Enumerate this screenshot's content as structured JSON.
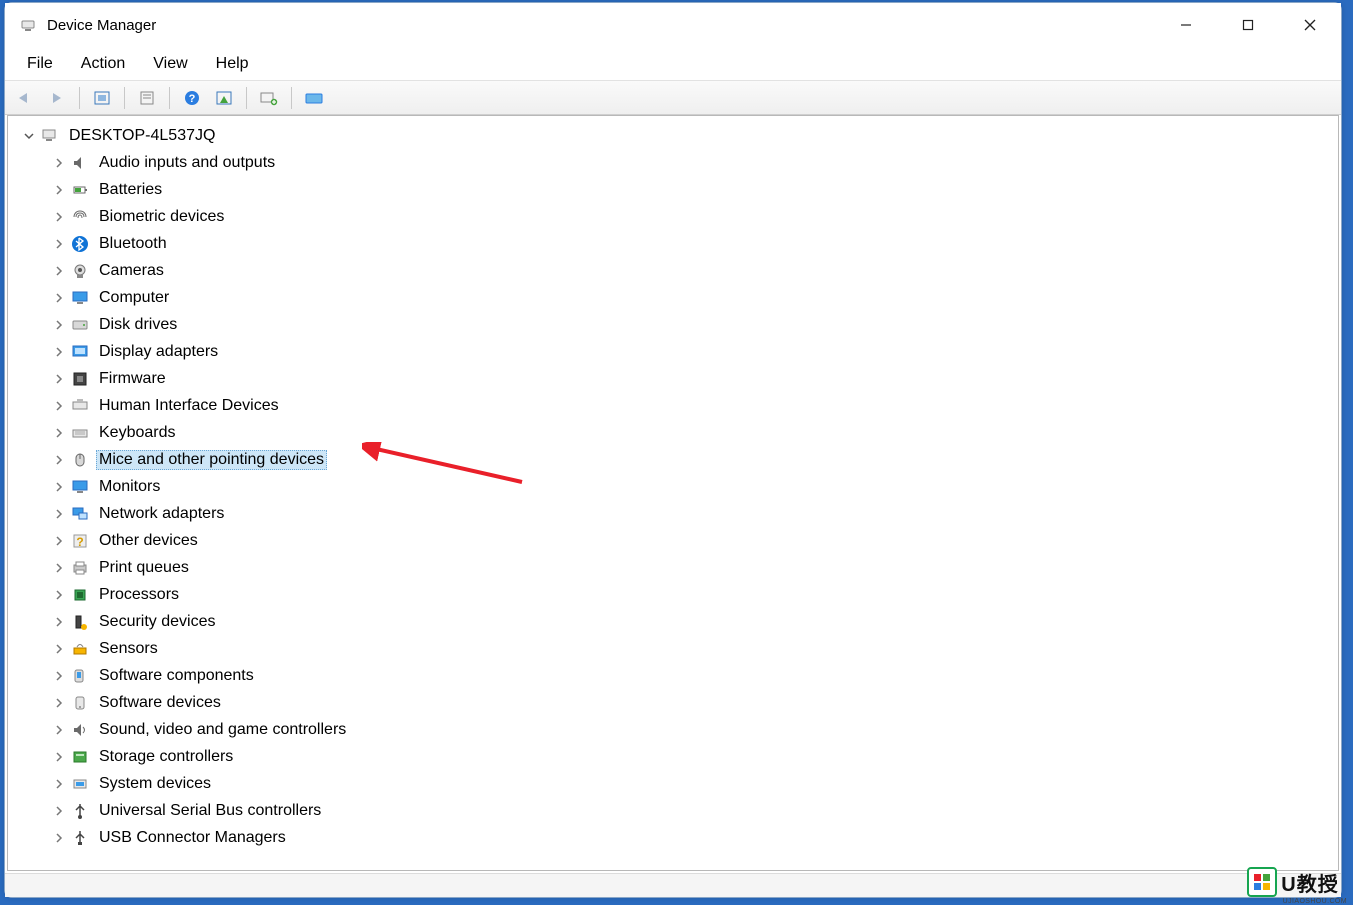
{
  "window": {
    "title": "Device Manager"
  },
  "menubar": {
    "items": [
      {
        "label": "File"
      },
      {
        "label": "Action"
      },
      {
        "label": "View"
      },
      {
        "label": "Help"
      }
    ]
  },
  "toolbar": {
    "buttons": [
      {
        "name": "back",
        "icon": "arrow-left-icon",
        "enabled": false
      },
      {
        "name": "forward",
        "icon": "arrow-right-icon",
        "enabled": false
      },
      {
        "sep": true
      },
      {
        "name": "show-hidden",
        "icon": "show-hidden-icon",
        "enabled": true
      },
      {
        "sep": true
      },
      {
        "name": "properties",
        "icon": "properties-icon",
        "enabled": true
      },
      {
        "sep": true
      },
      {
        "name": "help",
        "icon": "help-icon",
        "enabled": true
      },
      {
        "name": "devices-by-type",
        "icon": "devices-by-type-icon",
        "enabled": true
      },
      {
        "sep": true
      },
      {
        "name": "scan-hardware",
        "icon": "scan-hardware-icon",
        "enabled": true
      },
      {
        "sep": true
      },
      {
        "name": "add-legacy",
        "icon": "add-legacy-icon",
        "enabled": true
      }
    ]
  },
  "tree": {
    "root": {
      "label": "DESKTOP-4L537JQ",
      "icon": "computer-icon",
      "expanded": true
    },
    "nodes": [
      {
        "label": "Audio inputs and outputs",
        "icon": "audio-icon"
      },
      {
        "label": "Batteries",
        "icon": "battery-icon"
      },
      {
        "label": "Biometric devices",
        "icon": "biometric-icon"
      },
      {
        "label": "Bluetooth",
        "icon": "bluetooth-icon"
      },
      {
        "label": "Cameras",
        "icon": "camera-icon"
      },
      {
        "label": "Computer",
        "icon": "monitor-icon"
      },
      {
        "label": "Disk drives",
        "icon": "disk-icon"
      },
      {
        "label": "Display adapters",
        "icon": "display-adapter-icon"
      },
      {
        "label": "Firmware",
        "icon": "firmware-icon"
      },
      {
        "label": "Human Interface Devices",
        "icon": "hid-icon"
      },
      {
        "label": "Keyboards",
        "icon": "keyboard-icon"
      },
      {
        "label": "Mice and other pointing devices",
        "icon": "mouse-icon",
        "selected": true
      },
      {
        "label": "Monitors",
        "icon": "monitor-icon"
      },
      {
        "label": "Network adapters",
        "icon": "network-icon"
      },
      {
        "label": "Other devices",
        "icon": "unknown-icon"
      },
      {
        "label": "Print queues",
        "icon": "printer-icon"
      },
      {
        "label": "Processors",
        "icon": "cpu-icon"
      },
      {
        "label": "Security devices",
        "icon": "security-icon"
      },
      {
        "label": "Sensors",
        "icon": "sensor-icon"
      },
      {
        "label": "Software components",
        "icon": "software-component-icon"
      },
      {
        "label": "Software devices",
        "icon": "software-device-icon"
      },
      {
        "label": "Sound, video and game controllers",
        "icon": "sound-icon"
      },
      {
        "label": "Storage controllers",
        "icon": "storage-icon"
      },
      {
        "label": "System devices",
        "icon": "system-icon"
      },
      {
        "label": "Universal Serial Bus controllers",
        "icon": "usb-icon"
      },
      {
        "label": "USB Connector Managers",
        "icon": "usb-connector-icon"
      }
    ]
  },
  "watermark": {
    "text": "U教授",
    "sub": "UJIAOSHOU.COM"
  }
}
